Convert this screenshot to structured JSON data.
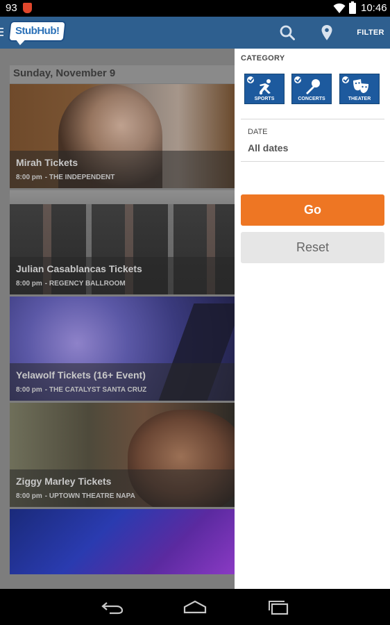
{
  "status_bar": {
    "notification_count": "93",
    "time": "10:46"
  },
  "action_bar": {
    "logo_text": "StubHub!",
    "filter_label": "FILTER",
    "colors": {
      "bar": "#2e5f8f"
    }
  },
  "content": {
    "date_header": "Sunday, November 9",
    "events": [
      {
        "name": "Mirah Tickets",
        "time": "8:00 pm",
        "venue": "- THE INDEPENDENT"
      },
      {
        "name": "Julian Casablancas Tickets",
        "time": "8:00 pm",
        "venue": "- REGENCY BALLROOM"
      },
      {
        "name": "Yelawolf Tickets (16+ Event)",
        "time": "8:00 pm",
        "venue": "- THE CATALYST SANTA CRUZ"
      },
      {
        "name": "Ziggy Marley Tickets",
        "time": "8:00 pm",
        "venue": "- UPTOWN THEATRE NAPA"
      },
      {
        "name": "",
        "time": "",
        "venue": ""
      }
    ]
  },
  "filter_panel": {
    "category_label": "CATEGORY",
    "categories": [
      {
        "label": "SPORTS",
        "icon": "sports-icon",
        "checked": true
      },
      {
        "label": "CONCERTS",
        "icon": "microphone-icon",
        "checked": true
      },
      {
        "label": "THEATER",
        "icon": "theater-masks-icon",
        "checked": true
      }
    ],
    "date_label": "DATE",
    "date_value": "All dates",
    "go_label": "Go",
    "reset_label": "Reset",
    "colors": {
      "go": "#ee7623",
      "tile": "#1d5a9e"
    }
  }
}
